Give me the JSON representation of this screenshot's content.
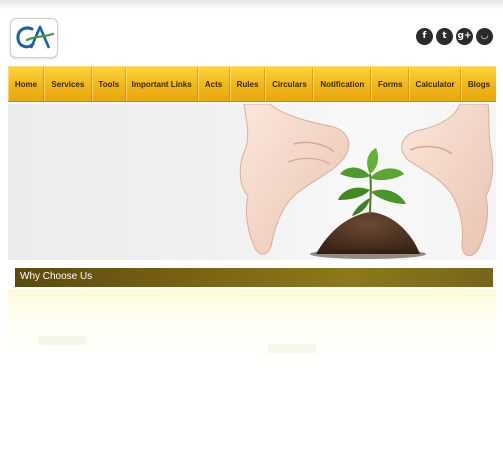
{
  "header": {
    "logo_text": "CA",
    "social": [
      {
        "name": "facebook",
        "glyph": "f"
      },
      {
        "name": "twitter",
        "glyph": "t"
      },
      {
        "name": "google-plus",
        "glyph": "g+"
      },
      {
        "name": "rss",
        "glyph": "◡"
      }
    ]
  },
  "nav": {
    "items": [
      "Home",
      "Services",
      "Tools",
      "Important Links",
      "Acts",
      "Rules",
      "Circulars",
      "Notification",
      "Forms",
      "Calculator",
      "Blogs"
    ]
  },
  "section": {
    "title": "Why Choose Us"
  },
  "colors": {
    "nav_yellow": "#f0b61b",
    "section_bar": "#7a6514",
    "logo_blue": "#1f5fa8",
    "logo_green": "#3a9b3a"
  }
}
